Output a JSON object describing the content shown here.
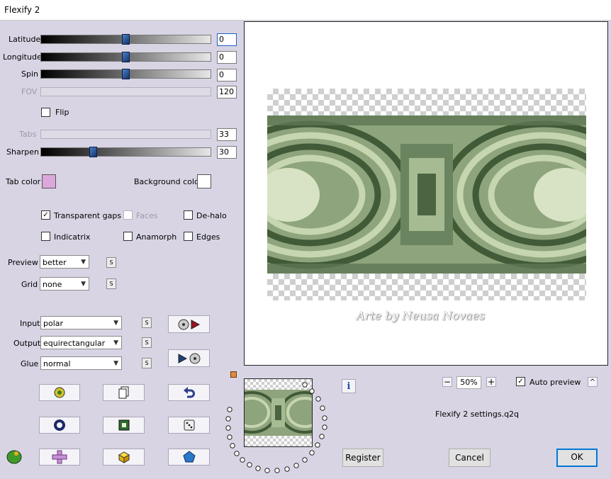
{
  "window": {
    "title": "Flexify 2"
  },
  "controls": {
    "latitude": {
      "label": "Latitude",
      "value": "0",
      "fill": 0.5
    },
    "longitude": {
      "label": "Longitude",
      "value": "0",
      "fill": 0.5
    },
    "spin": {
      "label": "Spin",
      "value": "0",
      "fill": 0.5
    },
    "fov": {
      "label": "FOV",
      "value": "120"
    },
    "flip": {
      "label": "Flip",
      "checked": false
    },
    "tabs": {
      "label": "Tabs",
      "value": "33"
    },
    "sharpen": {
      "label": "Sharpen",
      "value": "30",
      "fill": 0.3
    }
  },
  "colors": {
    "tab_color": {
      "label": "Tab color",
      "value": "#dca8dc"
    },
    "background_color": {
      "label": "Background color",
      "value": "#ffffff"
    }
  },
  "options": {
    "transparent_gaps": {
      "label": "Transparent gaps",
      "checked": true
    },
    "faces": {
      "label": "Faces",
      "checked": false
    },
    "de_halo": {
      "label": "De-halo",
      "checked": false
    },
    "indicatrix": {
      "label": "Indicatrix",
      "checked": false
    },
    "anamorph": {
      "label": "Anamorph",
      "checked": false
    },
    "edges": {
      "label": "Edges",
      "checked": false
    }
  },
  "dropdowns": {
    "preview": {
      "label": "Preview",
      "value": "better"
    },
    "grid": {
      "label": "Grid",
      "value": "none"
    },
    "input": {
      "label": "Input",
      "value": "polar"
    },
    "output": {
      "label": "Output",
      "value": "equirectangular"
    },
    "glue": {
      "label": "Glue",
      "value": "normal"
    }
  },
  "s_label": "S",
  "zoom": {
    "value": "50%",
    "minus": "−",
    "plus": "+"
  },
  "auto_preview": {
    "label": "Auto preview",
    "checked": true
  },
  "collapse_label": "^",
  "info_label": "i",
  "settings_file": "Flexify 2 settings.q2q",
  "watermark": "Arte by Neusa Novaes",
  "buttons": {
    "register": "Register",
    "cancel": "Cancel",
    "ok": "OK"
  },
  "accent": "#0078d7"
}
